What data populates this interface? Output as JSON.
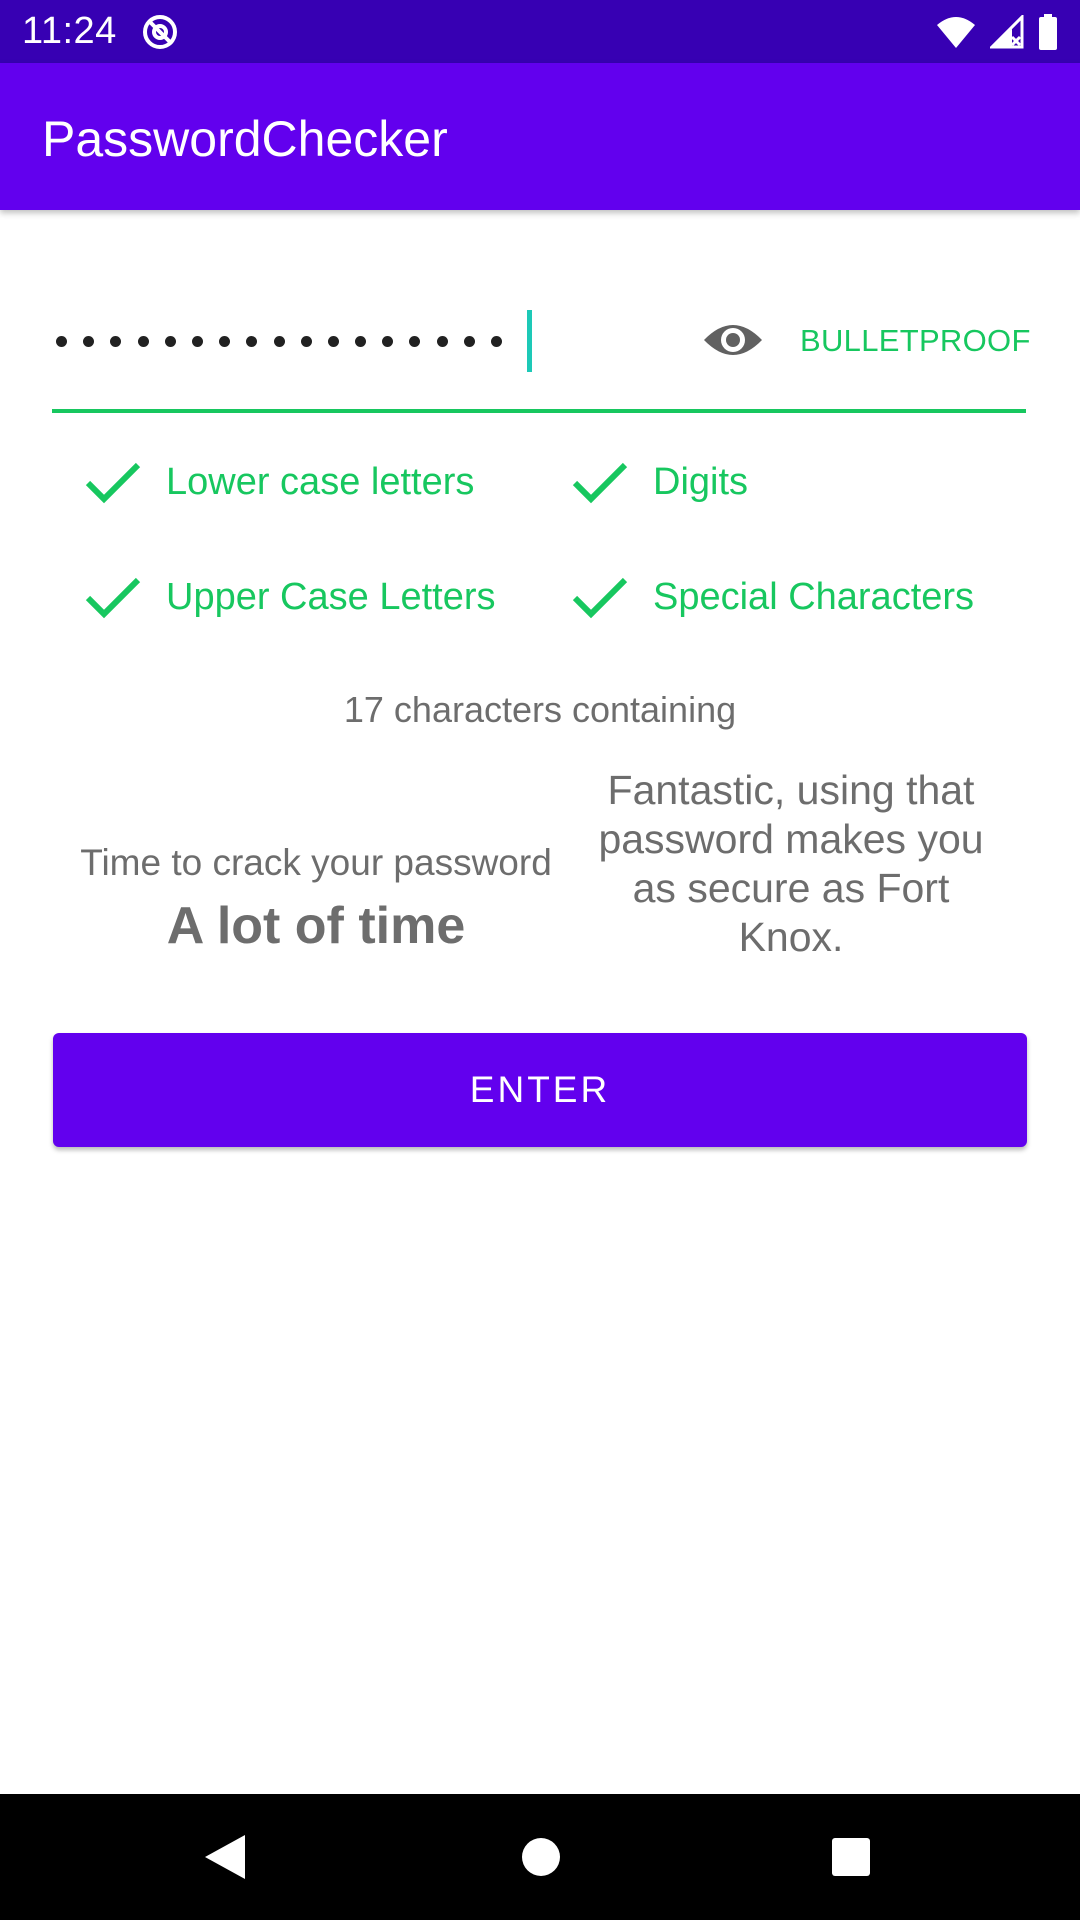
{
  "status_bar": {
    "time": "11:24",
    "icons": [
      "app-notification-icon",
      "wifi-icon",
      "signal-icon",
      "battery-icon"
    ]
  },
  "app_bar": {
    "title": "PasswordChecker"
  },
  "password_field": {
    "masked_char_count": 17,
    "strength_label": "BULLETPROOF",
    "visibility_icon": "eye-icon"
  },
  "criteria": [
    {
      "label": "Lower case letters",
      "met": true
    },
    {
      "label": "Digits",
      "met": true
    },
    {
      "label": "Upper Case Letters",
      "met": true
    },
    {
      "label": "Special Characters",
      "met": true
    }
  ],
  "summary": "17 characters containing",
  "crack_time": {
    "caption": "Time to crack your password",
    "value": "A lot of time"
  },
  "verdict": "Fantastic, using that password makes you as secure as Fort Knox.",
  "enter_button": {
    "label": "ENTER"
  },
  "colors": {
    "status_bar": "#3700b3",
    "app_bar": "#6200ee",
    "success": "#17c75f",
    "text_secondary": "#6d6d6d",
    "button": "#6200ee"
  },
  "nav_bar": {
    "icons": [
      "back-icon",
      "home-icon",
      "recents-icon"
    ]
  }
}
